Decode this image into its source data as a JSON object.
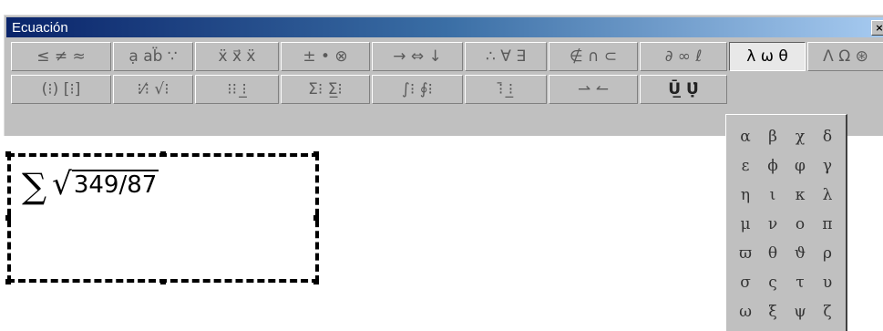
{
  "window": {
    "title": "Ecuación",
    "close_label": "×"
  },
  "toolbar_row1": [
    {
      "name": "relational-symbols-button",
      "label": "≤ ≠ ≈"
    },
    {
      "name": "spaces-ellipses-button",
      "label": "ạ ab̈ ∵"
    },
    {
      "name": "embellishments-button",
      "label": "ẍ x⃗ ẍ"
    },
    {
      "name": "operator-symbols-button",
      "label": "± • ⊗"
    },
    {
      "name": "arrow-symbols-button",
      "label": "→ ⇔ ↓"
    },
    {
      "name": "logical-symbols-button",
      "label": "∴ ∀ ∃"
    },
    {
      "name": "set-theory-symbols-button",
      "label": "∉ ∩ ⊂"
    },
    {
      "name": "misc-symbols-button",
      "label": "∂ ∞ ℓ"
    },
    {
      "name": "greek-lowercase-button",
      "label": "λ ω θ"
    },
    {
      "name": "greek-uppercase-button",
      "label": "Λ Ω ⊛"
    }
  ],
  "toolbar_row2": [
    {
      "name": "fence-templates-button",
      "label": "(⁝) [⁝]"
    },
    {
      "name": "fraction-radical-templates-button",
      "label": "⁝⁄⁝ √⁝"
    },
    {
      "name": "subscript-superscript-templates-button",
      "label": "⁝⁝ ⁝̲"
    },
    {
      "name": "summation-templates-button",
      "label": "Σ⁝ Σ̲⁝"
    },
    {
      "name": "integral-templates-button",
      "label": "∫⁝ ∮⁝"
    },
    {
      "name": "underbar-overbar-templates-button",
      "label": "⁝̄ ⁝̲"
    },
    {
      "name": "labeled-arrow-templates-button",
      "label": "⇀ ↼"
    },
    {
      "name": "products-set-templates-button",
      "label": "Ū̲ Ụ̇"
    }
  ],
  "equation": {
    "operator": "∑",
    "radical": "√",
    "radicand": "349/87"
  },
  "greek_palette": [
    "α",
    "β",
    "χ",
    "δ",
    "ε",
    "ϕ",
    "φ",
    "γ",
    "η",
    "ι",
    "κ",
    "λ",
    "μ",
    "ν",
    "ο",
    "π",
    "ϖ",
    "θ",
    "ϑ",
    "ρ",
    "σ",
    "ς",
    "τ",
    "υ",
    "ω",
    "ξ",
    "ψ",
    "ζ"
  ]
}
